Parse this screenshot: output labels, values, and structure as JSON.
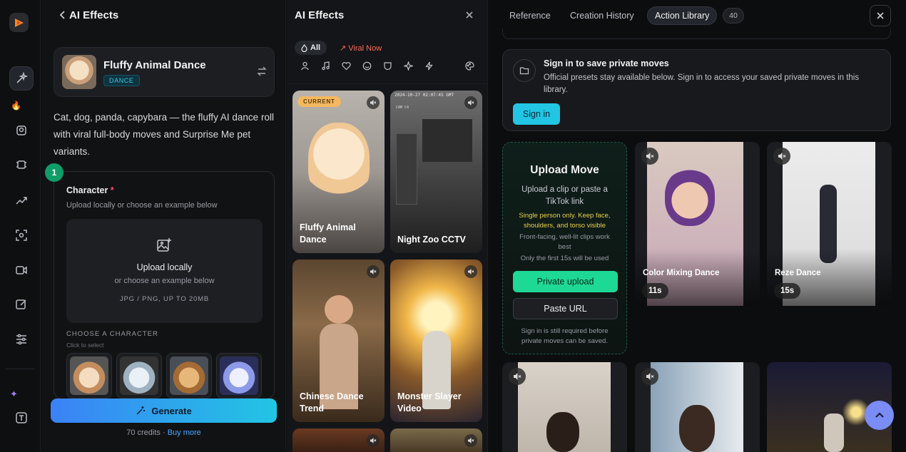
{
  "left_panel": {
    "title": "AI Effects",
    "effect": {
      "name": "Fluffy Animal Dance",
      "tag": "DANCE"
    },
    "description": "Cat, dog, panda, capybara — the fluffy AI dance roll with viral full-body moves and Surprise Me pet variants.",
    "step_number": "1",
    "character": {
      "label": "Character",
      "required_mark": "*",
      "subtitle": "Upload locally or choose an example below",
      "upload_title": "Upload locally",
      "upload_sub": "or choose an example below",
      "upload_formats": "JPG / PNG, UP TO 20MB",
      "choose_label": "CHOOSE A CHARACTER",
      "choose_sub": "Click to select"
    },
    "generate_label": "Generate",
    "credits_text": "70 credits",
    "separator": "·",
    "buy_more": "Buy more"
  },
  "middle_panel": {
    "title": "AI Effects",
    "filter_all": "All",
    "filter_viral": "Viral Now",
    "current_badge": "CURRENT",
    "cctv_overlay": "2024-10-27 02:07:45 GMT",
    "cctv_cam": "CAM C4",
    "tiles": [
      {
        "label": "Fluffy Animal Dance"
      },
      {
        "label": "Night Zoo CCTV"
      },
      {
        "label": "Chinese Dance Trend"
      },
      {
        "label": "Monster Slayer Video"
      }
    ]
  },
  "right_panel": {
    "tabs": [
      "Reference",
      "Creation History",
      "Action Library"
    ],
    "active_tab": "Action Library",
    "count": "40",
    "sign_in_box": {
      "title": "Sign in to save private moves",
      "body": "Official presets stay available below. Sign in to access your saved private moves in this library.",
      "button": "Sign in"
    },
    "upload_move": {
      "title": "Upload Move",
      "subtitle": "Upload a clip or paste a TikTok link",
      "warning": "Single person only. Keep face, shoulders, and torso visible",
      "tip1": "Front-facing, well-lit clips work best",
      "tip2": "Only the first 15s will be used",
      "private_upload": "Private upload",
      "paste_url": "Paste URL",
      "footnote": "Sign in is still required before private moves can be saved."
    },
    "videos": [
      {
        "label": "Color Mixing Dance",
        "duration": "11s"
      },
      {
        "label": "Reze Dance",
        "duration": "15s"
      }
    ]
  },
  "colors": {
    "accent_cyan": "#22c5e4",
    "accent_green": "#1ed996",
    "viral_red": "#ff6a5a",
    "current_badge": "#f4b860"
  }
}
